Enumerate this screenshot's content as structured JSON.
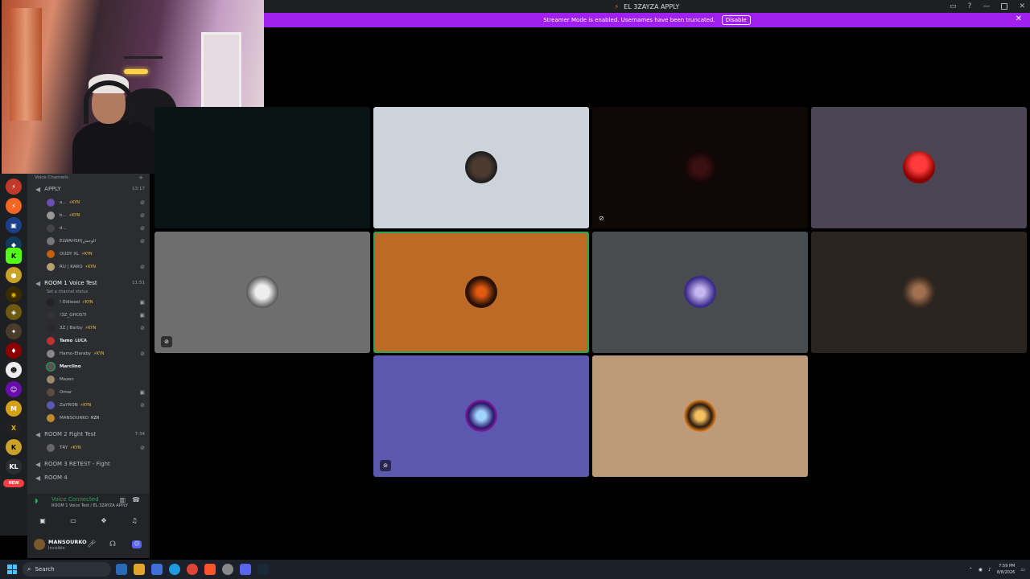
{
  "window": {
    "title": "EL 3ZAYZA APPLY"
  },
  "banner": {
    "text": "Streamer Mode is enabled. Usernames have been truncated.",
    "button": "Disable"
  },
  "sidebar": {
    "header": "Voice Channels",
    "channels": [
      {
        "name": "APPLY",
        "time": "13:17"
      },
      {
        "name": "ROOM 1 Voice Test",
        "time": "11:51",
        "status": "Set a channel status"
      },
      {
        "name": "ROOM 2 Fight Test",
        "time": "7:34"
      },
      {
        "name": "ROOM 3 RETEST - Fight"
      },
      {
        "name": "ROOM 4"
      }
    ],
    "apply_users": [
      "a...",
      "b...",
      "d...",
      "ELWAHSH|الوحش",
      "OUDY XL",
      "RU | KARO"
    ],
    "room1_users": [
      "! Eldiesel",
      "!3Z_GHOSTI",
      "3Z | Barby",
      "Tamo",
      "Hamo-Elaraby",
      "Marclino",
      "Mazen",
      "Omar",
      "ZaYRON",
      "MANSOURKO"
    ],
    "room2_users": [
      "TRY"
    ],
    "tags": {
      "kyn": "⚡KYN",
      "luca": "LUCA",
      "rzr": "RZR"
    }
  },
  "voice": {
    "status": "Voice Connected",
    "sub": "ROOM 1 Voice Test / EL 3ZAYZA APPLY"
  },
  "user": {
    "name": "MANSOURKO",
    "status": "Invisible"
  },
  "guild_badges": {
    "k": "K",
    "kl": "KL",
    "new": "NEW"
  },
  "taskbar": {
    "search": "Search",
    "time": "7:59 PM",
    "date": "8/8/2026"
  },
  "colors": {
    "brand": "#5865f2",
    "banner": "#a020f0",
    "speaking": "#23a55a"
  }
}
